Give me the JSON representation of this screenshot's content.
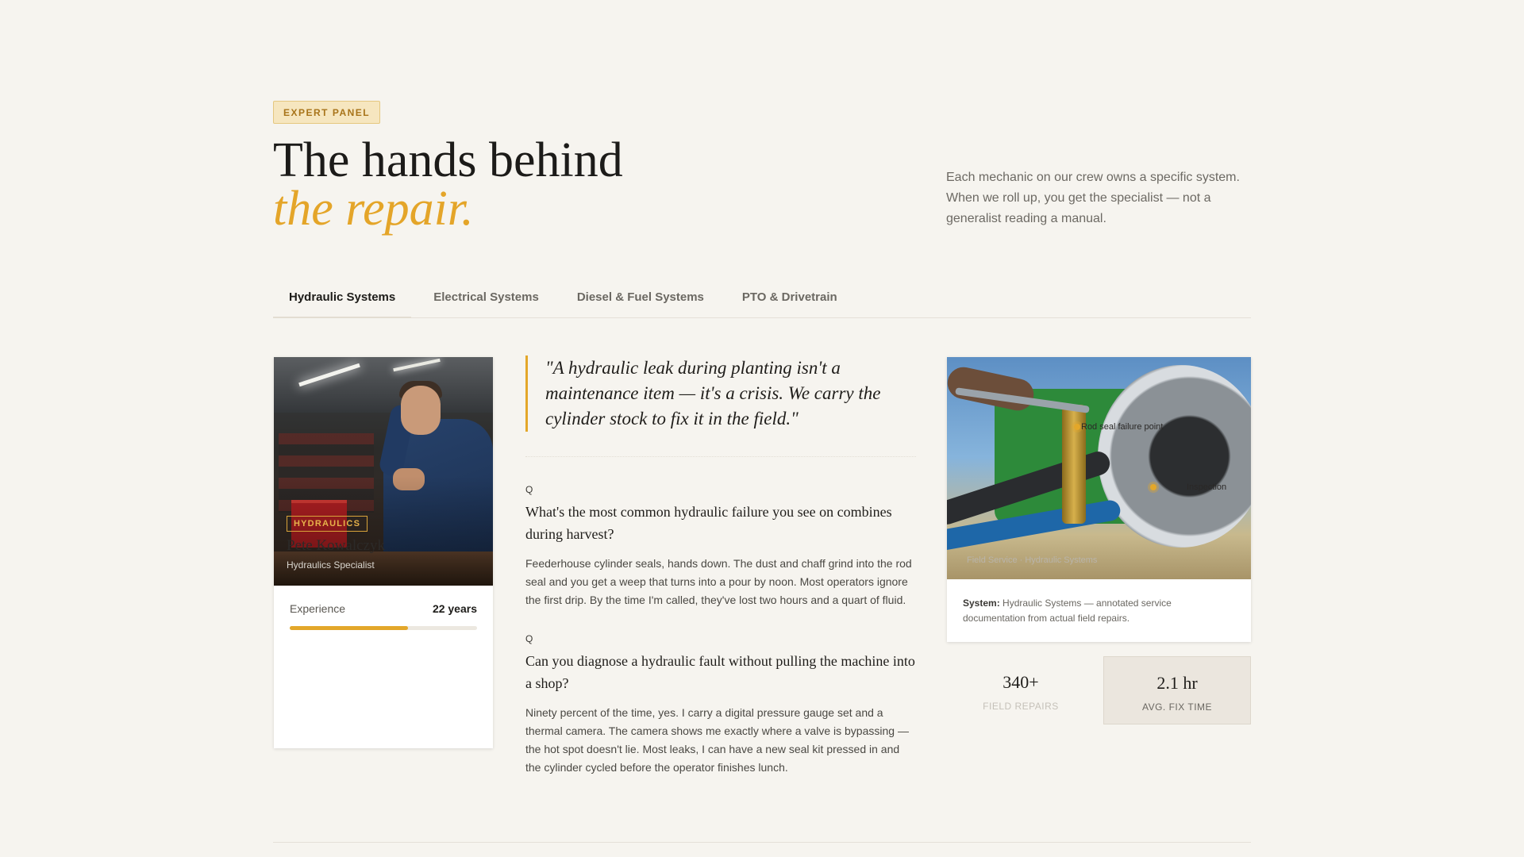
{
  "header": {
    "badge": "EXPERT PANEL",
    "headline_line1": "The hands behind",
    "headline_line2": "the repair.",
    "intro": "Each mechanic on our crew owns a specific system. When we roll up, you get the specialist — not a generalist reading a manual."
  },
  "tabs": [
    {
      "label": "Hydraulic Systems",
      "active": true
    },
    {
      "label": "Electrical Systems",
      "active": false
    },
    {
      "label": "Diesel & Fuel Systems",
      "active": false
    },
    {
      "label": "PTO & Drivetrain",
      "active": false
    }
  ],
  "profile": {
    "tag": "HYDRAULICS",
    "name": "Pete Kowalczyk",
    "role": "Hydraulics Specialist",
    "stat_label": "Experience",
    "stat_value": "22 years",
    "experience_fraction": 0.63
  },
  "interview": {
    "quote": "\"A hydraulic leak during planting isn't a maintenance item — it's a crisis. We carry the cylinder stock to fix it in the field.\"",
    "qa": [
      {
        "marker": "Q",
        "question": "What's the most common hydraulic failure you see on combines during harvest?",
        "answer": "Feederhouse cylinder seals, hands down. The dust and chaff grind into the rod seal and you get a weep that turns into a pour by noon. Most operators ignore the first drip. By the time I'm called, they've lost two hours and a quart of fluid."
      },
      {
        "marker": "Q",
        "question": "Can you diagnose a hydraulic fault without pulling the machine into a shop?",
        "answer": "Ninety percent of the time, yes. I carry a digital pressure gauge set and a thermal camera. The camera shows me exactly where a valve is bypassing — the hot spot doesn't lie. Most leaks, I can have a new seal kit pressed in and the cylinder cycled before the operator finishes lunch."
      }
    ]
  },
  "figure": {
    "annotation_1": "Rod seal failure point",
    "annotation_2": "Inspection",
    "image_label": "Field Service · Hydraulic Systems",
    "caption_bold": "System:",
    "caption_text": "Hydraulic Systems — annotated service documentation from actual field repairs."
  },
  "metrics": [
    {
      "value": "340+",
      "label": "FIELD REPAIRS"
    },
    {
      "value": "2.1 hr",
      "label": "AVG. FIX TIME"
    }
  ],
  "colors": {
    "accent": "#e3a72a",
    "background": "#f6f4ef"
  }
}
